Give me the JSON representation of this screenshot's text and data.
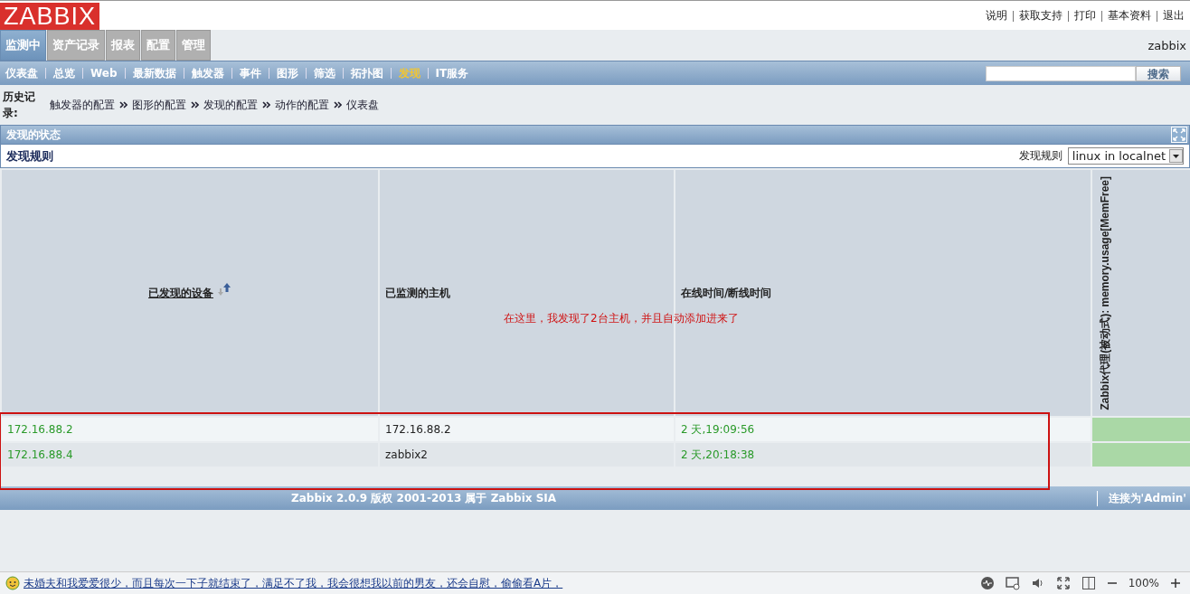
{
  "logo": "ZABBIX",
  "top_links": [
    "说明",
    "获取支持",
    "打印",
    "基本资料",
    "退出"
  ],
  "main_tabs": [
    {
      "label": "监测中",
      "selected": true
    },
    {
      "label": "资产记录",
      "selected": false
    },
    {
      "label": "报表",
      "selected": false
    },
    {
      "label": "配置",
      "selected": false
    },
    {
      "label": "管理",
      "selected": false
    }
  ],
  "user": "zabbix",
  "sub_menu": [
    {
      "label": "仪表盘",
      "selected": false
    },
    {
      "label": "总览",
      "selected": false
    },
    {
      "label": "Web",
      "selected": false
    },
    {
      "label": "最新数据",
      "selected": false
    },
    {
      "label": "触发器",
      "selected": false
    },
    {
      "label": "事件",
      "selected": false
    },
    {
      "label": "图形",
      "selected": false
    },
    {
      "label": "筛选",
      "selected": false
    },
    {
      "label": "拓扑图",
      "selected": false
    },
    {
      "label": "发现",
      "selected": true
    },
    {
      "label": "IT服务",
      "selected": false
    }
  ],
  "search": {
    "button": "搜索"
  },
  "history": {
    "label": "历史记录:",
    "items": [
      "触发器的配置",
      "图形的配置",
      "发现的配置",
      "动作的配置",
      "仪表盘"
    ]
  },
  "section_title": "发现的状态",
  "filter": {
    "title": "发现规则",
    "label": "发现规则",
    "value": "linux in localnet"
  },
  "table": {
    "columns": [
      {
        "label": "已发现的设备",
        "kind": "sortable"
      },
      {
        "label": "已监测的主机",
        "kind": "plain"
      },
      {
        "label": "在线时间/断线时间",
        "kind": "plain"
      },
      {
        "label": "Zabbix代理(被动式): memory.usage[MemFree]",
        "kind": "vertical"
      }
    ],
    "rows": [
      {
        "device": "172.16.88.2",
        "host": "172.16.88.2",
        "uptime": "2 天,19:09:56",
        "color": "#aad8a6"
      },
      {
        "device": "172.16.88.4",
        "host": "zabbix2",
        "uptime": "2 天,20:18:38",
        "color": "#aad8a6"
      }
    ]
  },
  "annotation": "在这里，我发现了2台主机，并且自动添加进来了",
  "footer": {
    "copyright": "Zabbix 2.0.9 版权 2001-2013 属于 Zabbix SIA",
    "connected": "连接为'Admin'"
  },
  "browser_status": {
    "link": "未婚夫和我爱爱很少，而且每次一下子就结束了，满足不了我，我会很想我以前的男友，还会自慰，偷偷看A片，",
    "zoom": "100%"
  }
}
